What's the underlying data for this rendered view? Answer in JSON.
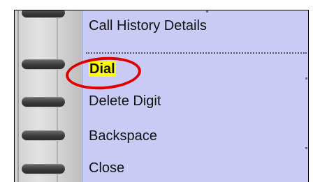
{
  "menu": {
    "items": [
      {
        "label": "Call History Details"
      },
      {
        "label": "Dial"
      },
      {
        "label": "Delete Digit"
      },
      {
        "label": "Backspace"
      },
      {
        "label": "Close"
      }
    ]
  },
  "annotation": {
    "ring_color": "#e00000",
    "highlight_color": "#ffff00"
  },
  "colors": {
    "menu_background": "#c9cbf5"
  }
}
